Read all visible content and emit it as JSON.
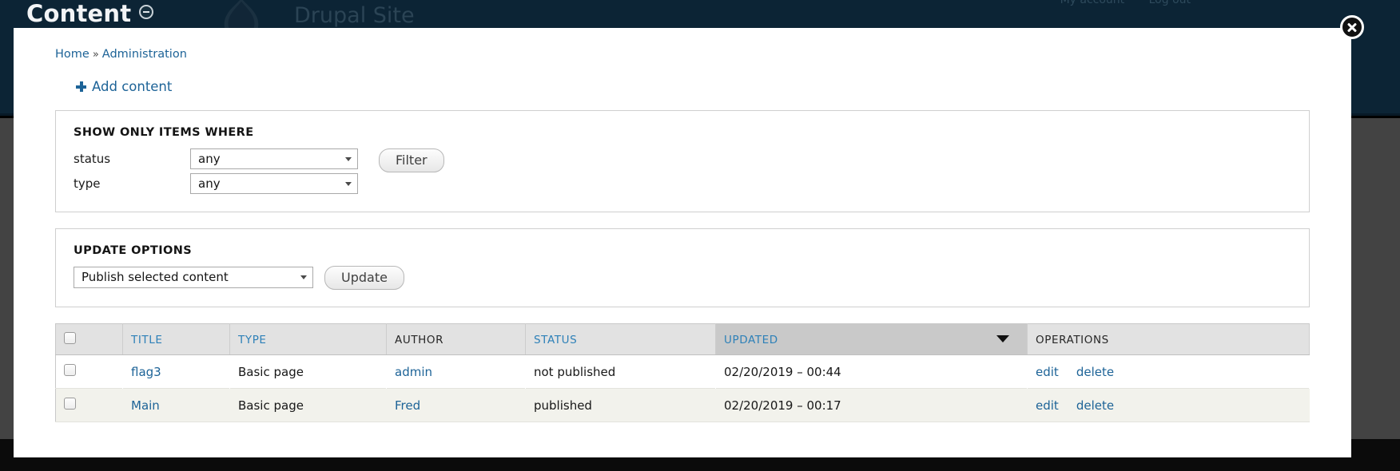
{
  "background": {
    "page_title": "Content",
    "collapse_icon": "minus-circle-icon",
    "site_name": "Drupal Site",
    "user_links": [
      "My account",
      "Log out"
    ]
  },
  "overlay": {
    "close_icon": "close-icon",
    "breadcrumb": {
      "home": "Home",
      "separator": "»",
      "current": "Administration"
    },
    "add_content": {
      "icon": "plus-icon",
      "label": "Add content"
    },
    "filter_fieldset": {
      "legend": "SHOW ONLY ITEMS WHERE",
      "rows": [
        {
          "label": "status",
          "value": "any"
        },
        {
          "label": "type",
          "value": "any"
        }
      ],
      "submit_label": "Filter"
    },
    "update_fieldset": {
      "legend": "UPDATE OPTIONS",
      "action_value": "Publish selected content",
      "submit_label": "Update"
    },
    "table": {
      "select_all_icon": "checkbox-icon",
      "columns": [
        {
          "key": "check",
          "label": ""
        },
        {
          "key": "title",
          "label": "TITLE"
        },
        {
          "key": "type",
          "label": "TYPE"
        },
        {
          "key": "author",
          "label": "AUTHOR"
        },
        {
          "key": "status",
          "label": "STATUS"
        },
        {
          "key": "updated",
          "label": "UPDATED"
        },
        {
          "key": "ops",
          "label": "OPERATIONS"
        }
      ],
      "sorted_column": "UPDATED",
      "sort_direction": "desc",
      "rows": [
        {
          "title": "flag3",
          "type": "Basic page",
          "author": "admin",
          "status": "not published",
          "updated": "02/20/2019 – 00:44",
          "edit": "edit",
          "delete": "delete"
        },
        {
          "title": "Main",
          "type": "Basic page",
          "author": "Fred",
          "status": "published",
          "updated": "02/20/2019 – 00:17",
          "edit": "edit",
          "delete": "delete"
        }
      ]
    }
  },
  "colors": {
    "header_navy": "#0c2435",
    "body_gray": "#434343",
    "link_blue": "#1d6397",
    "th_blue": "#2d80b8",
    "sorted_gray": "#c9c9c9",
    "row_alt": "#f2f2ec"
  }
}
